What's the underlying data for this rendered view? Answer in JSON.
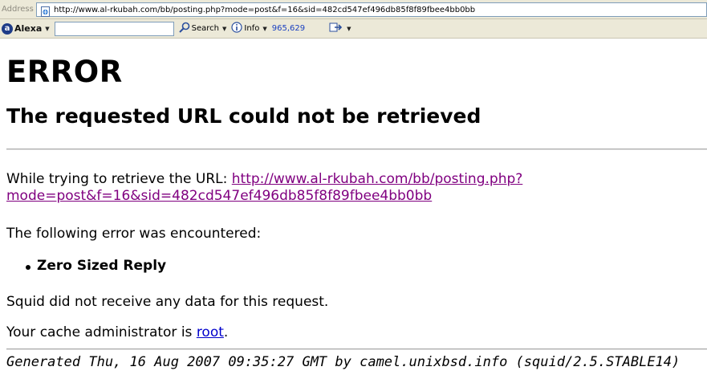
{
  "browser": {
    "address_label": "Address",
    "address_url": "http://www.al-rkubah.com/bb/posting.php?mode=post&f=16&sid=482cd547ef496db85f8f89fbee4bb0bb",
    "alexa_label": "Alexa",
    "search_label": "Search",
    "info_label": "Info",
    "rank_value": "965,629"
  },
  "page": {
    "title": "ERROR",
    "subtitle": "The requested URL could not be retrieved",
    "retrieve_prefix": "While trying to retrieve the URL: ",
    "retrieve_url_line1": "http://www.al-rkubah.com/bb/posting.php?",
    "retrieve_url_line2": "mode=post&f=16&sid=482cd547ef496db85f8f89fbee4bb0bb",
    "encountered": "The following error was encountered:",
    "error_item": "Zero Sized Reply",
    "explanation": "Squid did not receive any data for this request.",
    "admin_prefix": "Your cache administrator is ",
    "admin_link": "root",
    "admin_suffix": ".",
    "footer": "Generated Thu, 16 Aug 2007 09:35:27 GMT by camel.unixbsd.info (squid/2.5.STABLE14)"
  },
  "colors": {
    "chrome_bg": "#ece9d8",
    "visited_link": "#800080",
    "link": "#0000cc",
    "alexa_blue": "#1f3c88",
    "rank_blue": "#1a40c0"
  }
}
